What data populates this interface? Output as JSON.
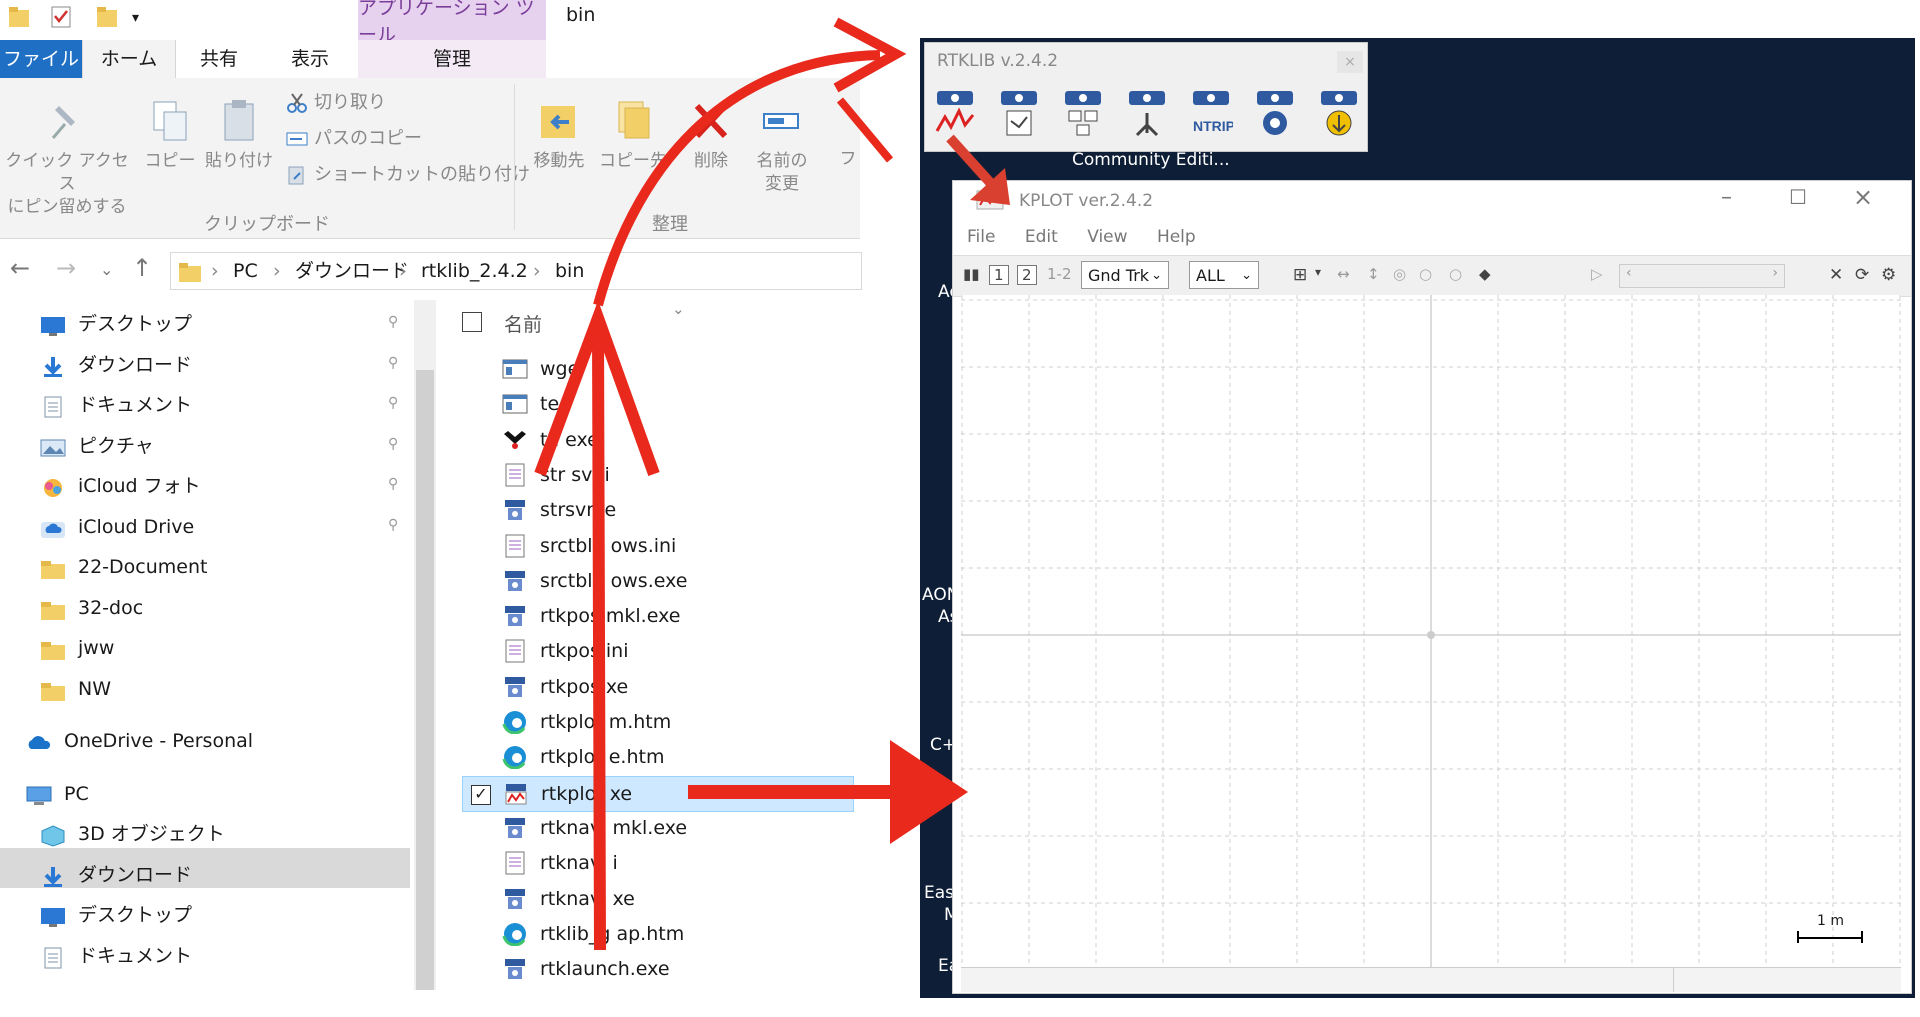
{
  "explorer": {
    "title_bar": {
      "contextual_tab": "アプリケーション ツール",
      "folder_title": "bin"
    },
    "ribbon_tabs": [
      "ファイル",
      "ホーム",
      "共有",
      "表示",
      "管理"
    ],
    "ribbon": {
      "pin_label": "クイック アクセス\nにピン留めする",
      "copy_label": "コピー",
      "paste_label": "貼り付け",
      "cut_label": "切り取り",
      "copy_path_label": "パスのコピー",
      "paste_shortcut_label": "ショートカットの貼り付け",
      "clipboard_group": "クリップボード",
      "move_to_label": "移動先",
      "copy_to_label": "コピー先",
      "delete_label": "削除",
      "rename_label": "名前の\n変更",
      "organize_group": "整理",
      "cut_off_label": "フ"
    },
    "breadcrumb": [
      "PC",
      "ダウンロード",
      "rtklib_2.4.2",
      "bin"
    ],
    "sidebar": {
      "quick_access": [
        {
          "label": "デスクトップ",
          "icon": "desktop-icon",
          "pinned": true
        },
        {
          "label": "ダウンロード",
          "icon": "download-icon",
          "pinned": true
        },
        {
          "label": "ドキュメント",
          "icon": "document-icon",
          "pinned": true
        },
        {
          "label": "ピクチャ",
          "icon": "picture-icon",
          "pinned": true
        },
        {
          "label": "iCloud フォト",
          "icon": "icloud-photos-icon",
          "pinned": true
        },
        {
          "label": "iCloud Drive",
          "icon": "icloud-drive-icon",
          "pinned": true
        },
        {
          "label": "22-Document",
          "icon": "folder-icon"
        },
        {
          "label": "32-doc",
          "icon": "folder-icon"
        },
        {
          "label": "jww",
          "icon": "folder-icon"
        },
        {
          "label": "NW",
          "icon": "folder-icon"
        }
      ],
      "onedrive": "OneDrive - Personal",
      "pc": "PC",
      "pc_items": [
        {
          "label": "3D オブジェクト",
          "icon": "3d-objects-icon"
        },
        {
          "label": "ダウンロード",
          "icon": "download-icon",
          "selected": true
        },
        {
          "label": "デスクトップ",
          "icon": "desktop-icon"
        },
        {
          "label": "ドキュメント",
          "icon": "document-icon"
        }
      ]
    },
    "file_list": {
      "column_name": "名前",
      "files": [
        {
          "name": "wge",
          "icon": "window-app-icon"
        },
        {
          "name": "tec",
          "icon": "window-app-icon"
        },
        {
          "name": "ta exe",
          "icon": "satellite-app-icon"
        },
        {
          "name": "str svr.i",
          "icon": "ini-file-icon"
        },
        {
          "name": "strsvr. e",
          "icon": "rtk-app-icon"
        },
        {
          "name": "srctblb ows.ini",
          "icon": "ini-file-icon"
        },
        {
          "name": "srctblb ows.exe",
          "icon": "rtk-app-icon"
        },
        {
          "name": "rtkpos mkl.exe",
          "icon": "rtk-app-icon"
        },
        {
          "name": "rtkpos ini",
          "icon": "ini-file-icon"
        },
        {
          "name": "rtkpos xe",
          "icon": "rtk-app-icon"
        },
        {
          "name": "rtkplot m.htm",
          "icon": "edge-icon"
        },
        {
          "name": "rtkplot e.htm",
          "icon": "edge-icon"
        },
        {
          "name": "rtkplot xe",
          "icon": "rtkplot-icon",
          "selected": true
        },
        {
          "name": "rtknavi mkl.exe",
          "icon": "rtk-app-icon"
        },
        {
          "name": "rtknavi i",
          "icon": "ini-file-icon"
        },
        {
          "name": "rtknavi xe",
          "icon": "rtk-app-icon"
        },
        {
          "name": "rtklib_g ap.htm",
          "icon": "edge-icon"
        },
        {
          "name": "rtklaunch.exe",
          "icon": "rtk-app-icon"
        }
      ]
    }
  },
  "rtklib": {
    "title": "RTKLIB v.2.4.2",
    "close": "×",
    "launcher_icons": [
      "rtkplot-icon",
      "rtkpost-icon",
      "rtknavi-icon",
      "strsvr-icon",
      "ntrip-icon",
      "rtkconv-icon",
      "rtkget-icon"
    ],
    "ntrip_label": "NTRIP",
    "community_label": "Community Editi...",
    "desktop_fragments": [
      "Ac",
      "AON",
      "As",
      "C+",
      "Ease",
      "M",
      "Ea"
    ]
  },
  "rtkplot": {
    "title": "KPLOT ver.2.4.2",
    "menu": [
      "File",
      "Edit",
      "View",
      "Help"
    ],
    "toolbar": {
      "btn1": "1",
      "btn2": "2",
      "btn12": "1-2",
      "plot_type": "Gnd Trk",
      "satellite_filter": "ALL"
    },
    "scale_label": "1 m"
  },
  "colors": {
    "arrow_red": "#e8291c",
    "file_tab_blue": "#1f6fc4",
    "rtklib_background": "#0e1e36",
    "selection_blue": "#cde8ff"
  }
}
